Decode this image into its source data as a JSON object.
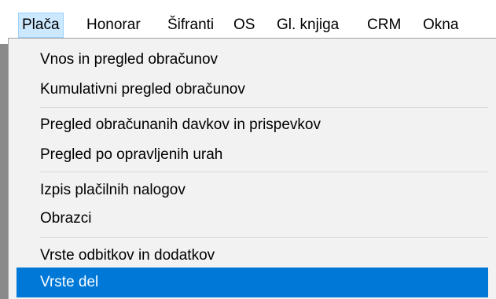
{
  "menubar": {
    "items": [
      {
        "label": "Plača",
        "active": true
      },
      {
        "label": "Honorar"
      },
      {
        "label": "Šifranti"
      },
      {
        "label": "OS"
      },
      {
        "label": "Gl. knjiga"
      },
      {
        "label": "CRM"
      },
      {
        "label": "Okna"
      }
    ]
  },
  "dropdown": {
    "groups": [
      [
        "Vnos in pregled obračunov",
        "Kumulativni pregled obračunov"
      ],
      [
        "Pregled obračunanih davkov in prispevkov",
        "Pregled po opravljenih urah"
      ],
      [
        "Izpis plačilnih nalogov",
        "Obrazci"
      ],
      [
        "Vrste odbitkov in dodatkov",
        "Vrste del"
      ]
    ],
    "highlighted_item": "Vrste del"
  },
  "colors": {
    "highlight": "#0078d7",
    "menu_background": "#f2f2f2",
    "active_menubar_item": "#cce8ff"
  }
}
